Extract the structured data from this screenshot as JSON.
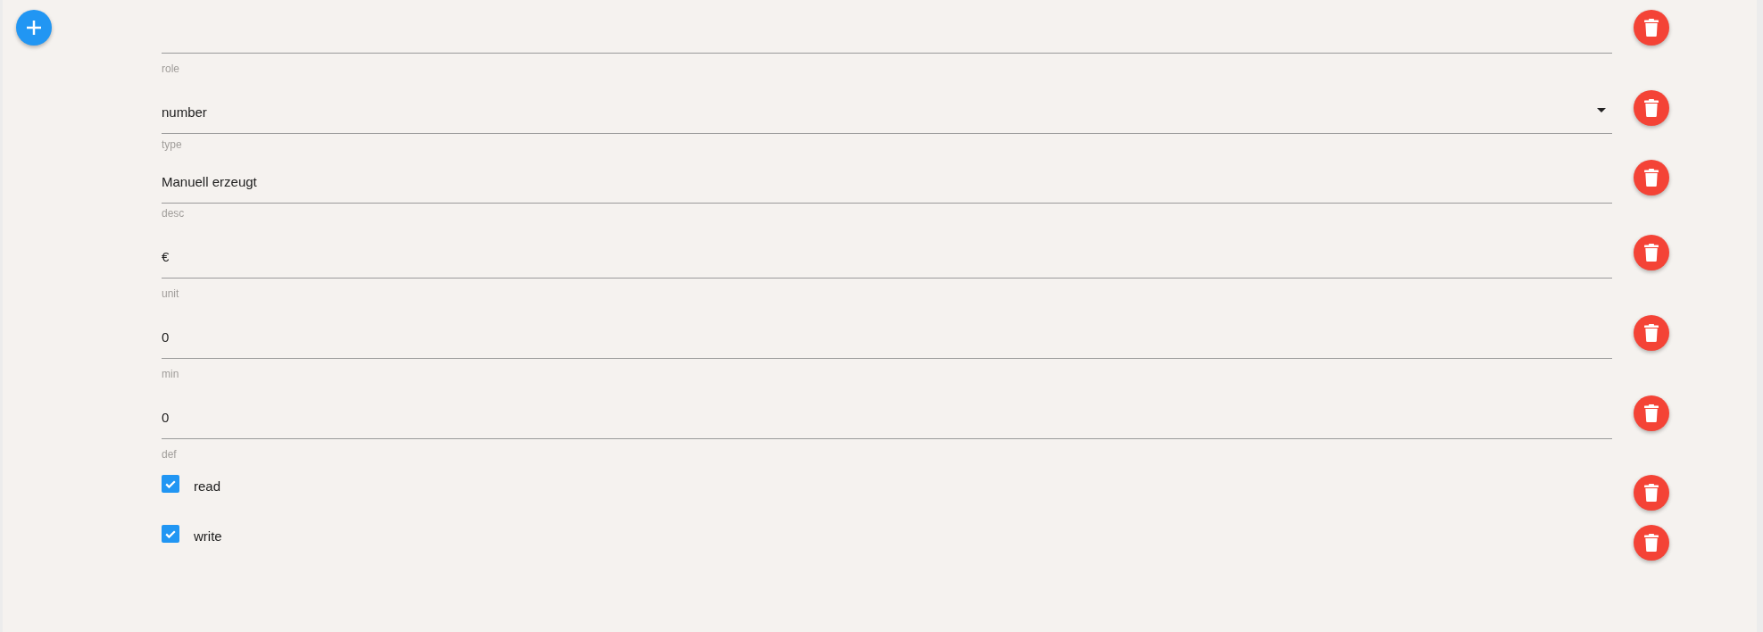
{
  "fields": [
    {
      "kind": "text",
      "label": "role"
    },
    {
      "kind": "select",
      "value": "number",
      "label": "type"
    },
    {
      "kind": "multiline",
      "value": "Manuell erzeugt",
      "label": "desc"
    },
    {
      "kind": "text",
      "value": "€",
      "label": "unit"
    },
    {
      "kind": "text",
      "value": "0",
      "label": "min"
    },
    {
      "kind": "text",
      "value": "0",
      "label": "def"
    },
    {
      "kind": "checkbox",
      "label": "read",
      "checked": true
    },
    {
      "kind": "checkbox",
      "label": "write",
      "checked": true
    }
  ]
}
